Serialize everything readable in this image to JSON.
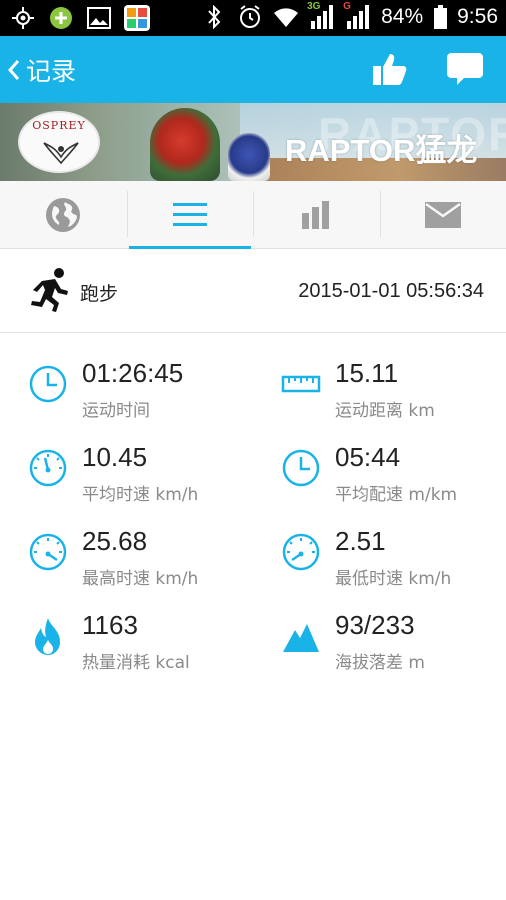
{
  "status_bar": {
    "network_3g": "3G",
    "network_g": "G",
    "battery": "84%",
    "time": "9:56",
    "icons": [
      "gps-icon",
      "add-app-icon",
      "gallery-icon",
      "app-store-icon",
      "bluetooth-icon",
      "alarm-icon",
      "wifi-icon",
      "signal-icon",
      "battery-icon"
    ]
  },
  "app_bar": {
    "back_label": "记录",
    "accent": "#19b3e8",
    "actions": [
      "thumbs-up-icon",
      "comment-icon"
    ]
  },
  "banner": {
    "brand": "OSPREY",
    "slogan": "RAPTOR猛龙",
    "watermark": "RAPTOR"
  },
  "tabs": {
    "items": [
      "globe-icon",
      "list-icon",
      "bar-chart-icon",
      "mail-icon"
    ],
    "active_index": 1
  },
  "activity": {
    "type": "跑步",
    "datetime": "2015-01-01 05:56:34"
  },
  "stats": [
    {
      "value": "01:26:45",
      "label": "运动时间",
      "icon": "clock-icon"
    },
    {
      "value": "15.11",
      "label": "运动距离 km",
      "icon": "ruler-icon"
    },
    {
      "value": "10.45",
      "label": "平均时速 km/h",
      "icon": "speedometer-icon"
    },
    {
      "value": "05:44",
      "label": "平均配速 m/km",
      "icon": "clock-icon"
    },
    {
      "value": "25.68",
      "label": "最高时速 km/h",
      "icon": "speedometer-icon"
    },
    {
      "value": "2.51",
      "label": "最低时速 km/h",
      "icon": "speedometer-icon"
    },
    {
      "value": "1163",
      "label": "热量消耗 kcal",
      "icon": "flame-icon"
    },
    {
      "value": "93/233",
      "label": "海拔落差 m",
      "icon": "mountain-icon"
    }
  ]
}
